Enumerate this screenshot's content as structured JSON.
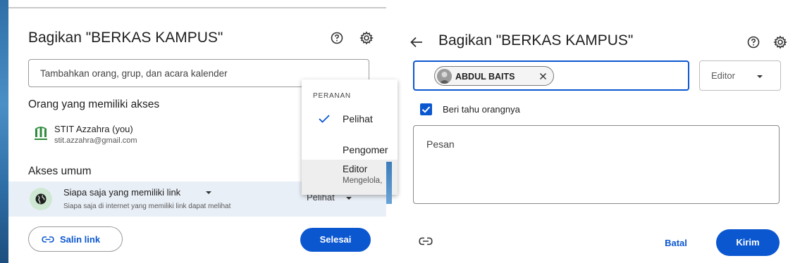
{
  "colors": {
    "accent": "#0b57d0",
    "general_row_bg": "#e9eff7",
    "globe_bg": "#cfe8d4"
  },
  "left_dialog": {
    "title": "Bagikan \"BERKAS KAMPUS\"",
    "icons": [
      "help-icon",
      "gear-icon"
    ],
    "add_input_placeholder": "Tambahkan orang, grup, dan acara kalender",
    "access_heading": "Orang yang memiliki akses",
    "owner": {
      "name": "STIT Azzahra (you)",
      "email": "stit.azzahra@gmail.com"
    },
    "general_access_heading": "Akses umum",
    "general_access": {
      "scope": "Siapa saja yang memiliki link",
      "description": "Siapa saja di internet yang memiliki link dapat melihat",
      "role": "Pelihat"
    },
    "copy_link_label": "Salin link",
    "done_label": "Selesai",
    "role_menu": {
      "header": "PERANAN",
      "items": [
        {
          "label": "Pelihat",
          "selected": true
        },
        {
          "label": "Pengomer",
          "selected": false
        },
        {
          "label": "Editor",
          "sublabel": "Mengelola,",
          "selected": false
        }
      ]
    }
  },
  "right_dialog": {
    "title": "Bagikan \"BERKAS KAMPUS\"",
    "icons": [
      "back-arrow-icon",
      "help-icon",
      "gear-icon"
    ],
    "chip_name": "ABDUL BAITS",
    "role": "Editor",
    "notify_label": "Beri tahu orangnya",
    "notify_checked": true,
    "message_placeholder": "Pesan",
    "cancel_label": "Batal",
    "send_label": "Kirim"
  }
}
